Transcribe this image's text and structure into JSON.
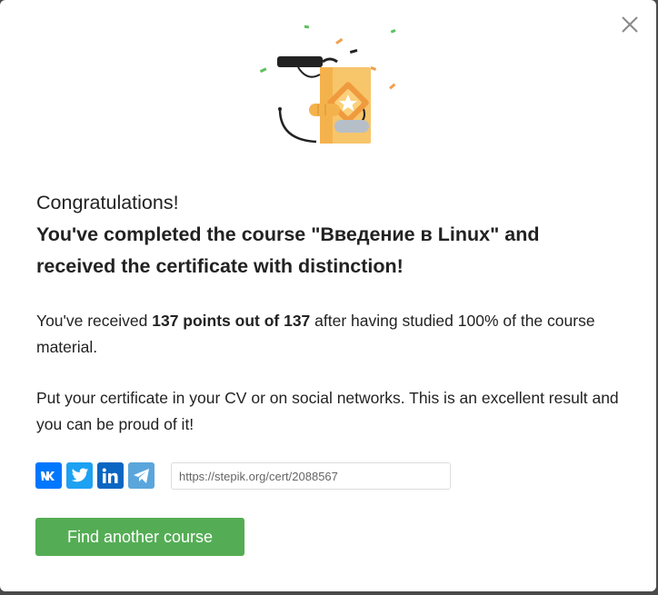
{
  "modal": {
    "close_icon": "close-icon",
    "illustration_icon": "certificate-illustration-icon",
    "headline": {
      "line1": "Congratulations!",
      "line2": "You've completed the course \"Введение в Linux\" and received the certificate with distinction!"
    },
    "points_text": {
      "prefix": "You've received ",
      "bold": "137 points out of 137",
      "suffix": " after having studied 100% of the course material."
    },
    "share_text": "Put your certificate in your CV or on social networks. This is an excellent result and you can be proud of it!",
    "share_buttons": [
      {
        "name": "vk",
        "icon": "vk-icon",
        "color": "#0077ff"
      },
      {
        "name": "twitter",
        "icon": "twitter-icon",
        "color": "#1da1f2"
      },
      {
        "name": "linkedin",
        "icon": "linkedin-icon",
        "color": "#0a66c2"
      },
      {
        "name": "telegram",
        "icon": "telegram-icon",
        "color": "#5aa6dc"
      }
    ],
    "cert_link": "https://stepik.org/cert/2088567",
    "find_button_label": "Find another course",
    "accent_color": "#54ad54"
  }
}
